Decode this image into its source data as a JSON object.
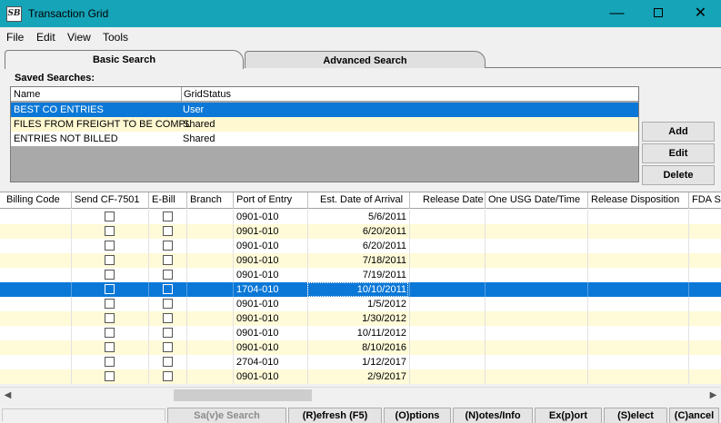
{
  "window": {
    "title": "Transaction Grid",
    "app_icon_text": "SB"
  },
  "menu": [
    "File",
    "Edit",
    "View",
    "Tools"
  ],
  "tabs": {
    "basic": "Basic Search",
    "advanced": "Advanced Search"
  },
  "saved": {
    "label": "Saved Searches:",
    "columns": [
      "Name",
      "GridStatus"
    ],
    "rows": [
      {
        "name": "BEST CO ENTRIES",
        "status": "User"
      },
      {
        "name": "FILES FROM FREIGHT TO BE COMPL",
        "status": "Shared"
      },
      {
        "name": "ENTRIES NOT BILLED",
        "status": "Shared"
      }
    ]
  },
  "side_buttons": {
    "add": "Add",
    "edit": "Edit",
    "delete": "Delete"
  },
  "grid": {
    "columns": [
      "Billing Code",
      "Send CF-7501",
      "E-Bill",
      "Branch",
      "Port of Entry",
      "Est. Date of Arrival",
      "Release Date",
      "One USG Date/Time",
      "Release Disposition",
      "FDA S"
    ],
    "rows": [
      {
        "port": "0901-010",
        "date": "5/6/2011"
      },
      {
        "port": "0901-010",
        "date": "6/20/2011"
      },
      {
        "port": "0901-010",
        "date": "6/20/2011"
      },
      {
        "port": "0901-010",
        "date": "7/18/2011"
      },
      {
        "port": "0901-010",
        "date": "7/19/2011"
      },
      {
        "port": "1704-010",
        "date": "10/10/2011"
      },
      {
        "port": "0901-010",
        "date": "1/5/2012"
      },
      {
        "port": "0901-010",
        "date": "1/30/2012"
      },
      {
        "port": "0901-010",
        "date": "10/11/2012"
      },
      {
        "port": "0901-010",
        "date": "8/10/2016"
      },
      {
        "port": "2704-010",
        "date": "1/12/2017"
      },
      {
        "port": "0901-010",
        "date": "2/9/2017"
      }
    ]
  },
  "bottom_buttons": {
    "save_search": "Sa(v)e Search",
    "refresh": "(R)efresh (F5)",
    "options": "(O)ptions",
    "notes": "(N)otes/Info",
    "export": "Ex(p)ort",
    "select": "(S)elect",
    "cancel": "(C)ancel"
  },
  "colors": {
    "titlebar": "#16a4b8",
    "selection": "#0b78d7",
    "alt_row": "#fffad8"
  }
}
